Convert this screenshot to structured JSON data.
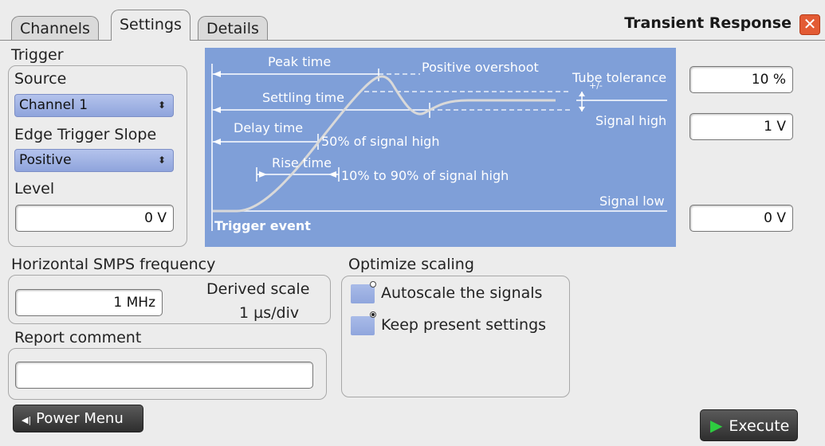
{
  "tabs": [
    {
      "label": "Channels",
      "active": false
    },
    {
      "label": "Settings",
      "active": true
    },
    {
      "label": "Details",
      "active": false
    }
  ],
  "dialog": {
    "title": "Transient Response",
    "close_icon": "close-icon"
  },
  "trigger": {
    "group_label": "Trigger",
    "source_label": "Source",
    "source_value": "Channel 1",
    "edge_label": "Edge Trigger Slope",
    "edge_value": "Positive",
    "level_label": "Level",
    "level_value": "0 V"
  },
  "diagram": {
    "peak_time": "Peak time",
    "positive_overshoot": "Positive overshoot",
    "tube_tolerance": "Tube tolerance",
    "plus_minus": "+/-",
    "settling_time": "Settling time",
    "signal_high": "Signal high",
    "delay_time": "Delay time",
    "fifty_percent": "50% of signal high",
    "rise_time": "Rise time",
    "ten_ninety": "10% to 90% of signal high",
    "signal_low": "Signal low",
    "trigger_event": "Trigger event"
  },
  "right_inputs": {
    "tube_tolerance_value": "10 %",
    "signal_high_value": "1 V",
    "signal_low_value": "0 V"
  },
  "horizontal": {
    "label": "Horizontal SMPS frequency",
    "frequency_value": "1 MHz",
    "derived_label": "Derived scale",
    "derived_value": "1 µs/div"
  },
  "report": {
    "label": "Report comment",
    "value": ""
  },
  "optimize": {
    "label": "Optimize scaling",
    "options": [
      {
        "label": "Autoscale the signals",
        "selected": false
      },
      {
        "label": "Keep present settings",
        "selected": true
      }
    ]
  },
  "footer": {
    "power_menu_label": "Power Menu",
    "execute_label": "Execute"
  },
  "colors": {
    "diagram_bg": "#7f9fd8",
    "accent_green": "#2ecc40",
    "close_red": "#e35b34"
  }
}
